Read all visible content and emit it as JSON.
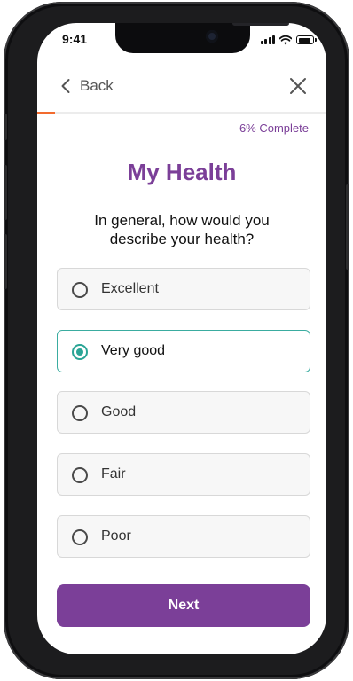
{
  "status_bar": {
    "time": "9:41"
  },
  "nav": {
    "back_label": "Back"
  },
  "progress": {
    "percent": 6,
    "label": "6% Complete",
    "color": "#f26b2e"
  },
  "page": {
    "title": "My Health",
    "question": "In general, how would you describe your health?"
  },
  "options": [
    {
      "label": "Excellent",
      "selected": false
    },
    {
      "label": "Very good",
      "selected": true
    },
    {
      "label": "Good",
      "selected": false
    },
    {
      "label": "Fair",
      "selected": false
    },
    {
      "label": "Poor",
      "selected": false
    }
  ],
  "buttons": {
    "next_label": "Next"
  },
  "colors": {
    "brand_purple": "#7b3f98",
    "selected_teal": "#2aa596",
    "progress_orange": "#f26b2e"
  },
  "icons": [
    "back-chevron-icon",
    "close-icon",
    "signal-icon",
    "wifi-icon",
    "battery-icon"
  ]
}
